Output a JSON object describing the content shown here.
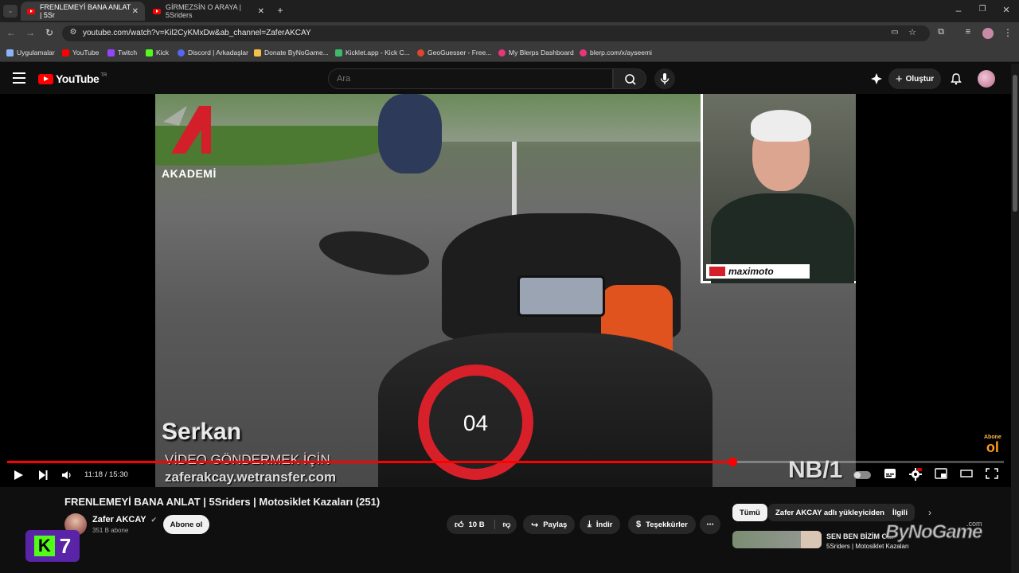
{
  "browser": {
    "tabs": [
      {
        "title": "FRENLEMEYİ BANA ANLAT | 5Sr",
        "active": true
      },
      {
        "title": "GİRMEZSİN O ARAYA | 5Sriders",
        "active": false
      }
    ],
    "url": "youtube.com/watch?v=Kil2CyKMxDw&ab_channel=ZaferAKCAY",
    "bookmarks": [
      {
        "label": "Uygulamalar",
        "color": "#8ab4f8"
      },
      {
        "label": "YouTube",
        "color": "#ff0000"
      },
      {
        "label": "Twitch",
        "color": "#9146ff"
      },
      {
        "label": "Kick",
        "color": "#53fc18"
      },
      {
        "label": "Discord | Arkadaşlar",
        "color": "#5865f2"
      },
      {
        "label": "Donate ByNoGame...",
        "color": "#f5c04a"
      },
      {
        "label": "Kicklet.app - Kick C...",
        "color": "#3dbb6a"
      },
      {
        "label": "GeoGuesser - Free...",
        "color": "#e0452f"
      },
      {
        "label": "My Blerps Dashboard",
        "color": "#e9357a"
      },
      {
        "label": "blerp.com/x/ayseemi",
        "color": "#e9357a"
      }
    ]
  },
  "header": {
    "logo_text": "YouTube",
    "region": "TR",
    "search_placeholder": "Ara",
    "create_label": "Oluştur"
  },
  "player": {
    "overlay": {
      "academy": "AKADEMİ",
      "name": "Serkan",
      "send_line1": "VİDEO GÖNDERMEK İÇİN",
      "send_line2": "zaferakcay.wetransfer.com",
      "countdown": "04",
      "plate": "NB/1",
      "sponsor": "maximoto",
      "abone_top": "Abone",
      "abone_bottom": "ol"
    },
    "time": "11:18 / 15:30",
    "progress": 0.728
  },
  "video": {
    "title": "FRENLEMEYİ BANA ANLAT | 5Sriders | Motosiklet Kazaları (251)",
    "channel": "Zafer AKCAY",
    "subscribers": "351 B abone",
    "subscribe_label": "Abone ol",
    "likes": "10 B",
    "share_label": "Paylaş",
    "download_label": "İndir",
    "thanks_label": "Teşekkürler"
  },
  "sidebar": {
    "chips": [
      "Tümü",
      "Zafer AKCAY adlı yükleyiciden",
      "İlgili"
    ],
    "rec_title": "SEN BEN BİZİM O...",
    "rec_sub": "5Sriders | Motosiklet Kazaları"
  },
  "watermark": {
    "bynogame": "ByNoGame",
    "com": ".com",
    "kick_number": "7"
  }
}
